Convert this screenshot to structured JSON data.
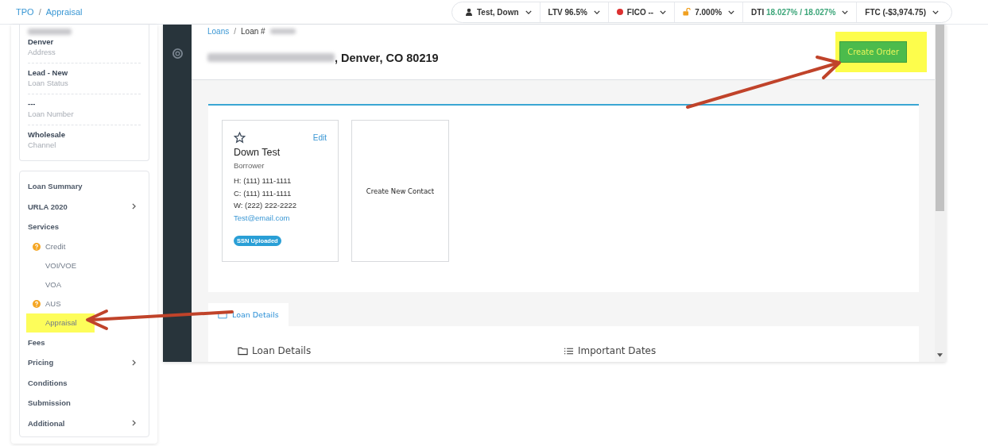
{
  "breadcrumb": [
    {
      "label": "TPO",
      "kind": "link"
    },
    {
      "separator": "/",
      "label": "Appraisal",
      "kind": "link"
    }
  ],
  "toolbar": [
    {
      "kind": "person",
      "label": "Test, Down"
    },
    {
      "kind": "plain",
      "label": "LTV 96.5%"
    },
    {
      "kind": "status",
      "label": "FICO --",
      "color": "#dc3030"
    },
    {
      "kind": "lock",
      "label": "7.000%"
    },
    {
      "kind": "ratio",
      "label": "DTI",
      "value": "18.027% / 18.027%"
    },
    {
      "kind": "plain",
      "label": "FTC (-$3,974.75)"
    }
  ],
  "summary_fields": [
    {
      "value": "Denver",
      "label": "Address",
      "redacted_above": true
    },
    {
      "value": "Lead - New",
      "label": "Loan Status",
      "redacted_above": false
    },
    {
      "value": "---",
      "label": "Loan Number",
      "redacted_above": false
    },
    {
      "value": "Wholesale",
      "label": "Channel",
      "redacted_above": false
    }
  ],
  "nav": [
    {
      "label": "Loan Summary",
      "expandable": false
    },
    {
      "label": "URLA 2020",
      "expandable": true
    },
    {
      "label": "Services",
      "expandable": false,
      "children": [
        {
          "label": "Credit",
          "warning": true,
          "highlighted": false
        },
        {
          "label": "VOI/VOE",
          "warning": false,
          "highlighted": false
        },
        {
          "label": "VOA",
          "warning": false,
          "highlighted": false
        },
        {
          "label": "AUS",
          "warning": true,
          "highlighted": false
        },
        {
          "label": "Appraisal",
          "warning": false,
          "highlighted": true
        }
      ]
    },
    {
      "label": "Fees",
      "expandable": false
    },
    {
      "label": "Pricing",
      "expandable": true
    },
    {
      "label": "Conditions",
      "expandable": false
    },
    {
      "label": "Submission",
      "expandable": false
    },
    {
      "label": "Additional",
      "expandable": true
    }
  ],
  "main": {
    "breadcrumb": [
      {
        "label": "Loans",
        "kind": "link"
      },
      {
        "separator": "/",
        "label": "Loan #",
        "kind": "current"
      }
    ],
    "title": ", Denver, CO 80219",
    "create_order": {
      "label": "Create Order",
      "highlighted": true
    },
    "contact": {
      "name": "Down Test",
      "role": "Borrower",
      "edit": "Edit",
      "phones": [
        "H: (111) 111-1111",
        "C: (111) 111-1111",
        "W: (222) 222-2222"
      ],
      "email": "Test@email.com",
      "badge": "SSN Uploaded",
      "starred": false
    },
    "new_contact": "Create New Contact",
    "tabs": [
      {
        "label": "Loan Details",
        "selected": true
      }
    ],
    "sections": [
      {
        "kind": "folder",
        "label": "Loan Details"
      },
      {
        "kind": "list",
        "label": "Important Dates"
      }
    ]
  }
}
